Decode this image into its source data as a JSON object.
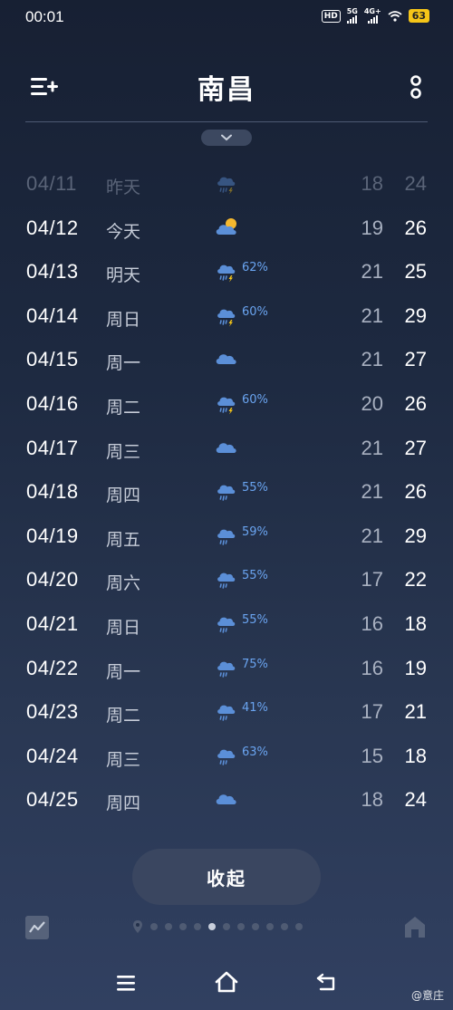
{
  "status_bar": {
    "time": "00:01",
    "hd_label": "HD",
    "hd_sub": "1 2",
    "net1": "5G",
    "net2": "4G+",
    "battery": "63"
  },
  "header": {
    "city": "南昌"
  },
  "forecast": [
    {
      "date": "04/11",
      "day": "昨天",
      "icon": "thunder-rain-icon",
      "prob": "",
      "low": "18",
      "high": "24",
      "past": true
    },
    {
      "date": "04/12",
      "day": "今天",
      "icon": "partly-cloudy-icon",
      "prob": "",
      "low": "19",
      "high": "26",
      "past": false
    },
    {
      "date": "04/13",
      "day": "明天",
      "icon": "thunder-rain-icon",
      "prob": "62%",
      "low": "21",
      "high": "25",
      "past": false
    },
    {
      "date": "04/14",
      "day": "周日",
      "icon": "thunder-rain-icon",
      "prob": "60%",
      "low": "21",
      "high": "29",
      "past": false
    },
    {
      "date": "04/15",
      "day": "周一",
      "icon": "cloudy-icon",
      "prob": "",
      "low": "21",
      "high": "27",
      "past": false
    },
    {
      "date": "04/16",
      "day": "周二",
      "icon": "thunder-rain-icon",
      "prob": "60%",
      "low": "20",
      "high": "26",
      "past": false
    },
    {
      "date": "04/17",
      "day": "周三",
      "icon": "cloudy-icon",
      "prob": "",
      "low": "21",
      "high": "27",
      "past": false
    },
    {
      "date": "04/18",
      "day": "周四",
      "icon": "rain-icon",
      "prob": "55%",
      "low": "21",
      "high": "26",
      "past": false
    },
    {
      "date": "04/19",
      "day": "周五",
      "icon": "rain-icon",
      "prob": "59%",
      "low": "21",
      "high": "29",
      "past": false
    },
    {
      "date": "04/20",
      "day": "周六",
      "icon": "rain-icon",
      "prob": "55%",
      "low": "17",
      "high": "22",
      "past": false
    },
    {
      "date": "04/21",
      "day": "周日",
      "icon": "rain-icon",
      "prob": "55%",
      "low": "16",
      "high": "18",
      "past": false
    },
    {
      "date": "04/22",
      "day": "周一",
      "icon": "rain-icon",
      "prob": "75%",
      "low": "16",
      "high": "19",
      "past": false
    },
    {
      "date": "04/23",
      "day": "周二",
      "icon": "rain-icon",
      "prob": "41%",
      "low": "17",
      "high": "21",
      "past": false
    },
    {
      "date": "04/24",
      "day": "周三",
      "icon": "rain-icon",
      "prob": "63%",
      "low": "15",
      "high": "18",
      "past": false
    },
    {
      "date": "04/25",
      "day": "周四",
      "icon": "cloudy-icon",
      "prob": "",
      "low": "18",
      "high": "24",
      "past": false
    }
  ],
  "collapse_label": "收起",
  "page_indicator": {
    "count": 11,
    "active_index": 4
  },
  "watermark": "@意庄",
  "colors": {
    "precip": "#6aa4f0",
    "cloud": "#5b8fd8",
    "sun": "#f5b82e",
    "lightning": "#f5c518"
  }
}
